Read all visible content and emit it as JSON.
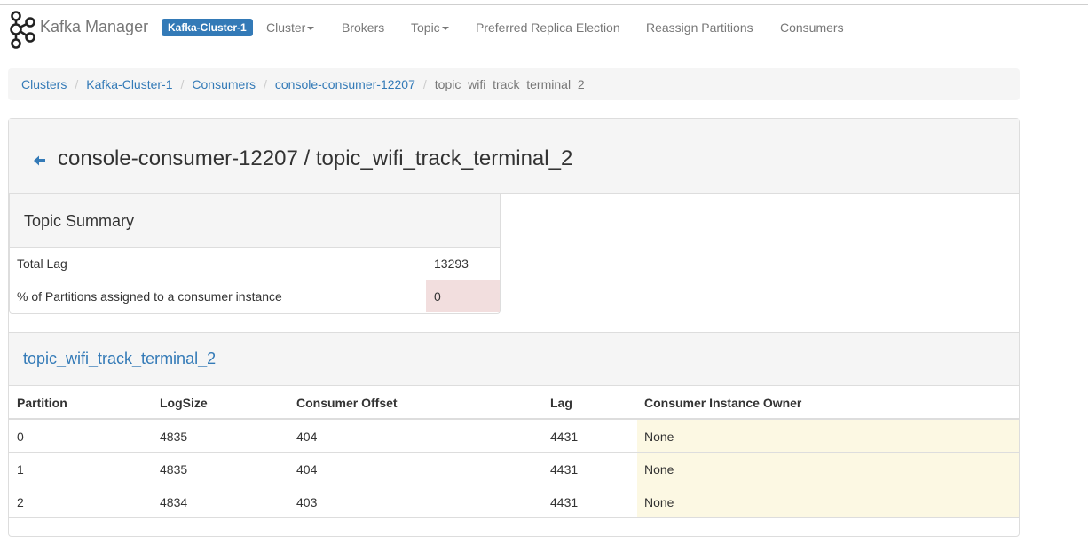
{
  "navbar": {
    "brand": "Kafka Manager",
    "cluster_badge": "Kafka-Cluster-1",
    "items": [
      {
        "label": "Cluster",
        "dropdown": true
      },
      {
        "label": "Brokers",
        "dropdown": false
      },
      {
        "label": "Topic",
        "dropdown": true
      },
      {
        "label": "Preferred Replica Election",
        "dropdown": false
      },
      {
        "label": "Reassign Partitions",
        "dropdown": false
      },
      {
        "label": "Consumers",
        "dropdown": false
      }
    ]
  },
  "breadcrumb": {
    "items": [
      "Clusters",
      "Kafka-Cluster-1",
      "Consumers",
      "console-consumer-12207"
    ],
    "active": "topic_wifi_track_terminal_2",
    "separator": "/"
  },
  "page": {
    "title": "console-consumer-12207 / topic_wifi_track_terminal_2",
    "back_icon": "arrow-left-icon"
  },
  "summary": {
    "title": "Topic Summary",
    "rows": [
      {
        "label": "Total Lag",
        "value": "13293"
      },
      {
        "label": "% of Partitions assigned to a consumer instance",
        "value": "0"
      }
    ]
  },
  "partitions": {
    "title": "topic_wifi_track_terminal_2",
    "columns": [
      "Partition",
      "LogSize",
      "Consumer Offset",
      "Lag",
      "Consumer Instance Owner"
    ],
    "rows": [
      {
        "partition": "0",
        "logsize": "4835",
        "offset": "404",
        "lag": "4431",
        "owner": "None"
      },
      {
        "partition": "1",
        "logsize": "4835",
        "offset": "404",
        "lag": "4431",
        "owner": "None"
      },
      {
        "partition": "2",
        "logsize": "4834",
        "offset": "403",
        "lag": "4431",
        "owner": "None"
      }
    ]
  },
  "colors": {
    "link": "#337ab7",
    "danger_cell": "#f2dede",
    "warning_cell": "#fcf8e3",
    "panel_heading": "#f5f5f5"
  }
}
